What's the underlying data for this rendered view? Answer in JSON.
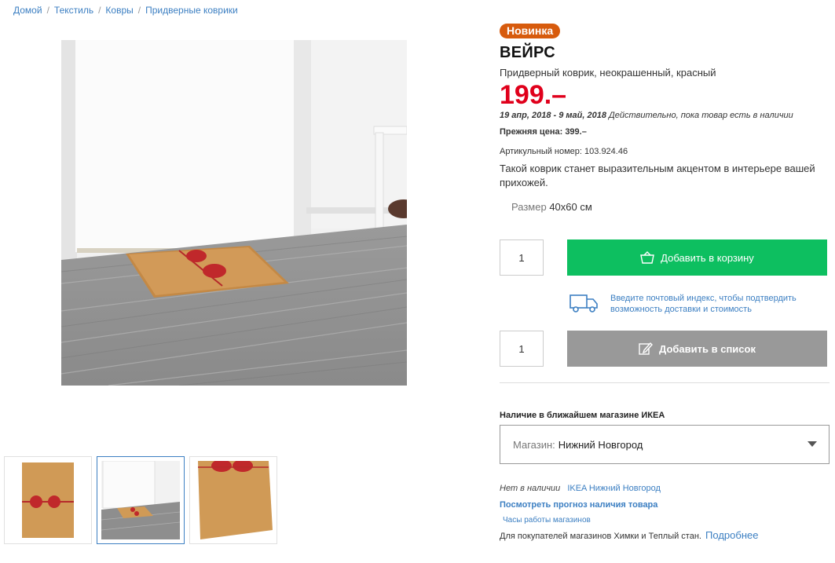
{
  "breadcrumb": {
    "items": [
      "Домой",
      "Текстиль",
      "Ковры",
      "Придверные коврики"
    ],
    "separator": "/"
  },
  "product": {
    "badge": "Новинка",
    "name": "ВЕЙРС",
    "description": "Придверный коврик, неокрашенный, красный",
    "price": "199.–",
    "validity_dates": "19 апр, 2018 - 9 май, 2018",
    "validity_note": "Действительно, пока товар есть в наличии",
    "old_price_label": "Прежняя цена:",
    "old_price_value": "399.–",
    "article_label": "Артикульный номер:",
    "article_value": "103.924.46",
    "about": "Такой коврик станет выразительным акцентом в интерьере вашей прихожей.",
    "size_label": "Размер",
    "size_value": "40x60 см"
  },
  "cart": {
    "quantity": "1",
    "add_label": "Добавить в корзину",
    "icon": "basket-icon"
  },
  "delivery": {
    "text": "Введите почтовый индекс, чтобы подтвердить возможность доставки и стоимость",
    "icon": "truck-icon"
  },
  "list": {
    "quantity": "1",
    "add_label": "Добавить в список",
    "icon": "edit-list-icon"
  },
  "availability": {
    "title": "Наличие в ближайшем магазине ИКЕА",
    "store_label": "Магазин:",
    "store_value": "Нижний Новгород",
    "stock_status": "Нет в наличии",
    "stock_store": "IKEA Нижний Новгород",
    "forecast_link": "Посмотреть прогноз наличия товара",
    "hours_link": "Часы работы магазинов",
    "buyers_note": "Для покупателей магазинов Химки и Теплый стан.",
    "more_link": "Подробнее"
  },
  "colors": {
    "accent_green": "#0dbf60",
    "price_red": "#e0001b",
    "badge_orange": "#d75b0d",
    "link_blue": "#3c7fc2",
    "list_grey": "#999999"
  }
}
